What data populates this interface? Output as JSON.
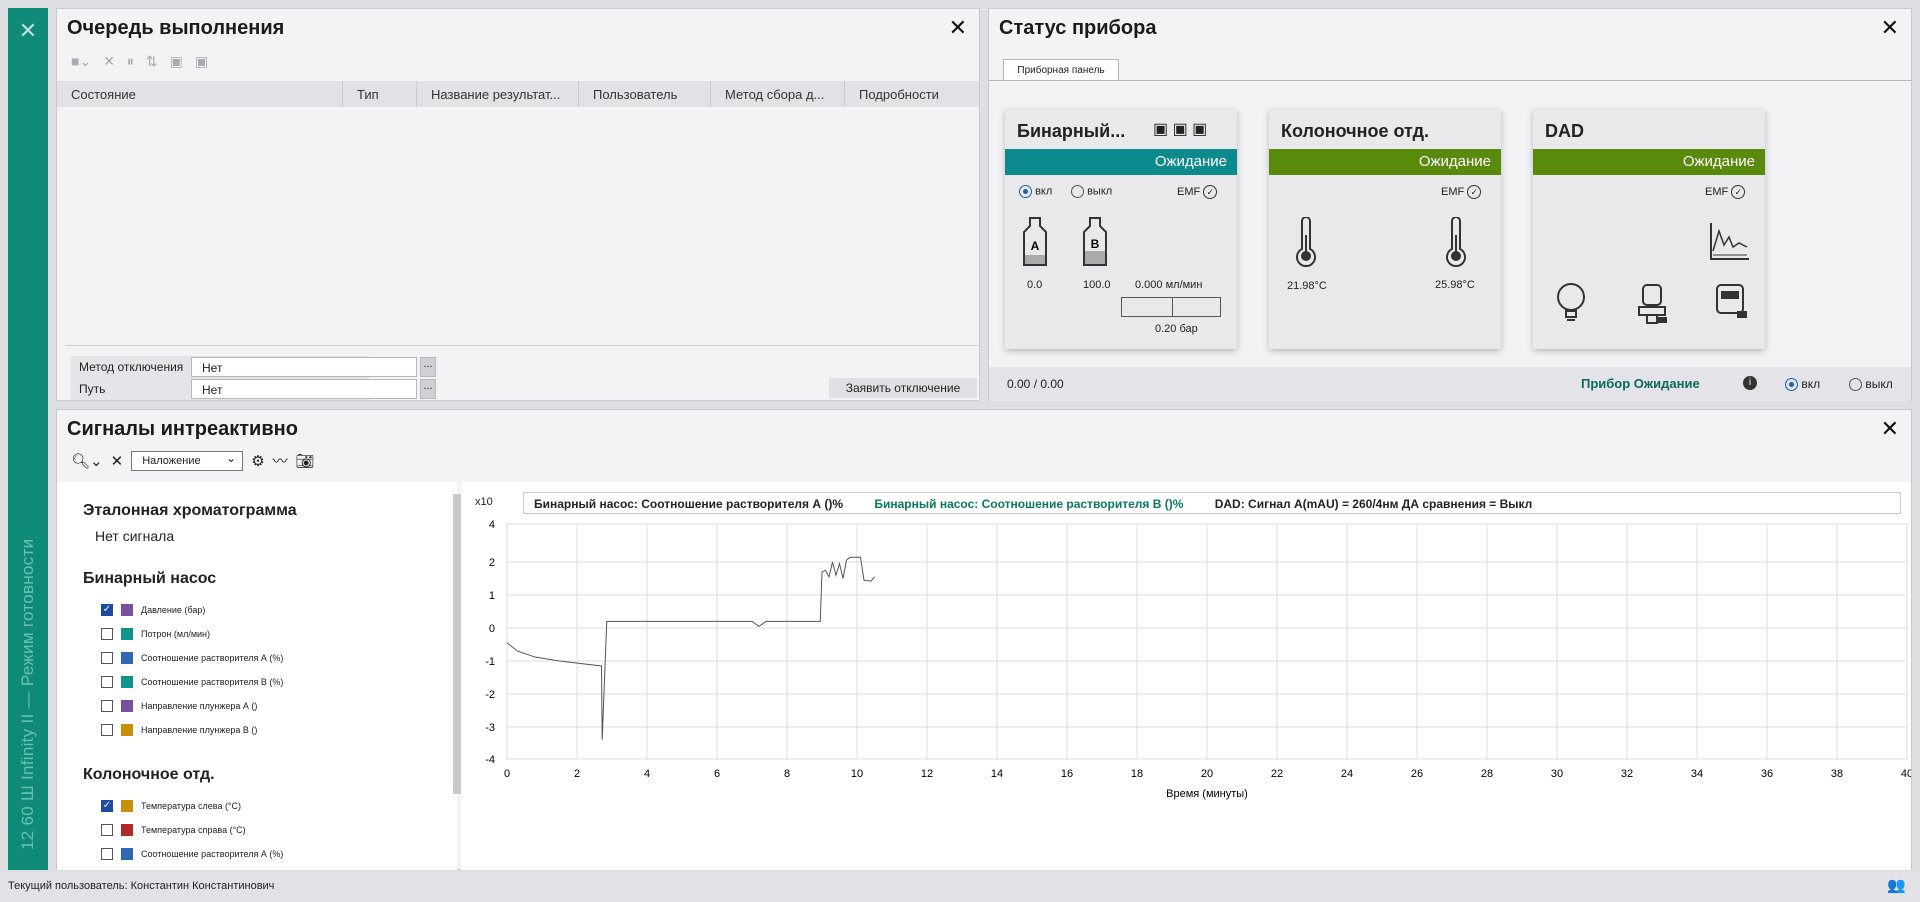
{
  "sidebar": {
    "close": "✕",
    "vertical_text": "12 60 Ш Infinity II — Режим готовности"
  },
  "queue": {
    "title": "Очередь выполнения",
    "close": "✕",
    "columns": [
      "Состояние",
      "Тип",
      "Название результат...",
      "Пользователь",
      "Метод сбора д...",
      "Подробности"
    ],
    "footer": {
      "method_label": "Метод отключения",
      "method_value": "Нет",
      "path_label": "Путь",
      "path_value": "Нет",
      "dots": "...",
      "button": "Заявить отключение"
    }
  },
  "status": {
    "title": "Статус прибора",
    "close": "✕",
    "tab": "Приборная панель",
    "binary": {
      "title": "Бинарный...",
      "state": "Ожидание",
      "state_color": "#0c8a8e",
      "on": "вкл",
      "off": "выкл",
      "emf": "EMF",
      "bottle_a": "A",
      "bottle_b": "B",
      "val_a": "0.0",
      "val_b": "100.0",
      "flow": "0.000 мл/мин",
      "pressure": "0.20 бар"
    },
    "column": {
      "title": "Колоночное отд.",
      "state": "Ожидание",
      "state_color": "#5a8a0c",
      "emf": "EMF",
      "temp_left": "21.98°C",
      "temp_right": "25.98°C"
    },
    "dad": {
      "title": "DAD",
      "state": "Ожидание",
      "state_color": "#5a8a0c",
      "emf": "EMF"
    },
    "bar": {
      "ratio": "0.00 / 0.00",
      "status": "Прибор Ожидание",
      "on": "вкл",
      "off": "выкл"
    }
  },
  "signals": {
    "title": "Сигналы интреактивно",
    "close": "✕",
    "overlay": "Наложение",
    "ref_title": "Эталонная хроматограмма",
    "ref_none": "Нет сигнала",
    "groups": [
      {
        "title": "Бинарный насос",
        "items": [
          {
            "label": "Давление (бар)",
            "checked": true,
            "color": "#7a4fa0"
          },
          {
            "label": "Потрон (мл/мин)",
            "checked": false,
            "color": "#12948a"
          },
          {
            "label": "Соотношение растворителя А (%)",
            "checked": false,
            "color": "#2f67b5"
          },
          {
            "label": "Соотношение растворителя В (%)",
            "checked": false,
            "color": "#12948a"
          },
          {
            "label": "Направление плунжера А ()",
            "checked": false,
            "color": "#7a4fa0"
          },
          {
            "label": "Направление плунжера В ()",
            "checked": false,
            "color": "#c8900a"
          }
        ]
      },
      {
        "title": "Колоночное отд.",
        "items": [
          {
            "label": "Температура слева (°C)",
            "checked": true,
            "color": "#c8900a"
          },
          {
            "label": "Температура справа (°C)",
            "checked": false,
            "color": "#b02a2a"
          },
          {
            "label": "Соотношение растворителя А (%)",
            "checked": false,
            "color": "#2f67b5"
          }
        ]
      }
    ],
    "legend": {
      "mult": "x10",
      "s1": "Бинарный насос: Соотношение растворителя А ()%",
      "s2": "Бинарный насос: Соотношение растворителя В ()%",
      "s3": "DAD: Сигнал А(mAU) = 260/4нм ДА сравнения = Выкл",
      "s2_color": "#0a7a5a"
    }
  },
  "chart_data": {
    "type": "line",
    "xlabel": "Время (минуты)",
    "ylabel": "",
    "xlim": [
      0,
      40
    ],
    "ylim": [
      -4,
      4
    ],
    "xticks": [
      0,
      2,
      4,
      6,
      8,
      10,
      12,
      14,
      16,
      18,
      20,
      22,
      24,
      26,
      28,
      30,
      32,
      34,
      36,
      38,
      40
    ],
    "yticks": [
      -4,
      -3,
      -2,
      -1,
      0,
      1,
      2,
      4
    ],
    "series": [
      {
        "color": "#555555",
        "points": [
          [
            0,
            -0.45
          ],
          [
            0.3,
            -0.7
          ],
          [
            0.8,
            -0.88
          ],
          [
            1.5,
            -1.0
          ],
          [
            2.7,
            -1.15
          ],
          [
            2.72,
            -3.4
          ],
          [
            2.85,
            0.2
          ],
          [
            7.0,
            0.2
          ],
          [
            7.2,
            0.05
          ],
          [
            7.4,
            0.2
          ],
          [
            8.95,
            0.2
          ],
          [
            9.0,
            1.7
          ],
          [
            9.1,
            1.75
          ],
          [
            9.2,
            1.55
          ],
          [
            9.3,
            2.0
          ],
          [
            9.4,
            1.6
          ],
          [
            9.5,
            1.95
          ],
          [
            9.6,
            1.5
          ],
          [
            9.7,
            2.1
          ],
          [
            9.8,
            2.25
          ],
          [
            10.1,
            2.25
          ],
          [
            10.2,
            1.45
          ],
          [
            10.4,
            1.42
          ],
          [
            10.5,
            1.55
          ]
        ]
      }
    ]
  },
  "bottom": {
    "user": "Текущий пользователь: Константин Константинович",
    "users_icon": "👥"
  }
}
